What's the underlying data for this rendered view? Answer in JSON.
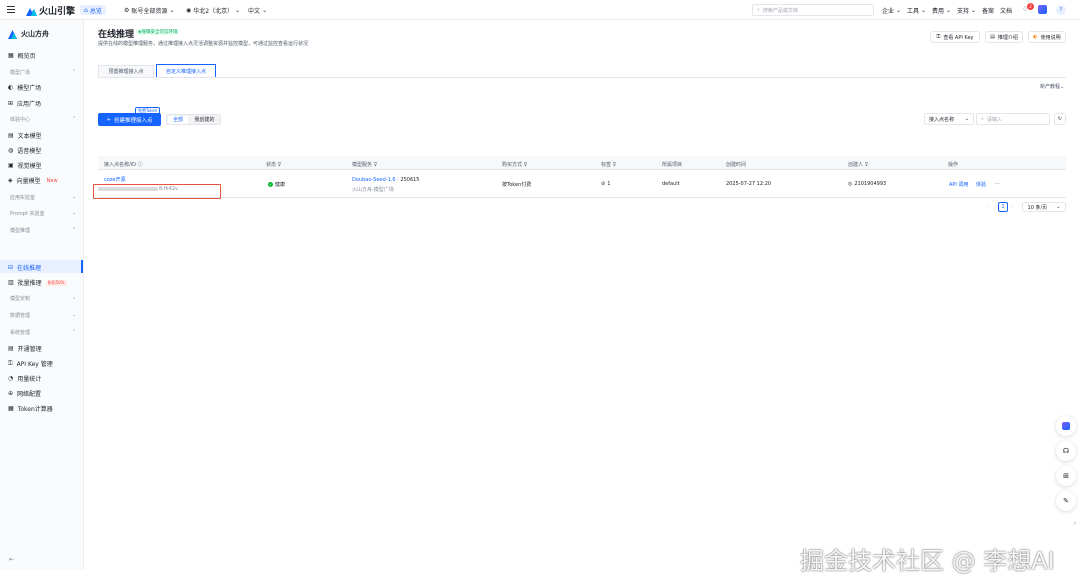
{
  "topbar": {
    "brand": "火山引擎",
    "home_tab": "总览",
    "resource_scope": "账号全部资源",
    "region": "华北2（北京）",
    "language": "中文",
    "search_placeholder": "搜索产品或文档",
    "menus": [
      "企业",
      "工具",
      "费用",
      "支持",
      "备案",
      "文档"
    ],
    "badge_count": "2"
  },
  "sidebar": {
    "product_name": "火山方舟",
    "overview": "概览页",
    "groups": {
      "explore": "模型广场",
      "experience": "体验中心",
      "app_lab": "应用实验室",
      "prompt": "Prompt 实验室",
      "model_inference": "模型推理",
      "model_custom": "模型定制",
      "data_mgmt": "数据管理",
      "system_mgmt": "系统管理"
    },
    "items": {
      "model_square": "模型广场",
      "app_square": "应用广场",
      "text_model": "文本模型",
      "voice_model": "语音模型",
      "vision_model": "视觉模型",
      "vector_model": "向量模型",
      "new_badge": "New",
      "online_infer": "在线推理",
      "batch_infer": "批量推理",
      "batch_badge": "折扣50%",
      "activation": "开通管理",
      "api_key": "API Key 管理",
      "usage_stats": "用量统计",
      "network": "网络配置",
      "token_calc": "Token计算器"
    }
  },
  "page": {
    "title": "在线推理",
    "safety_tag": "保障安全可信环境",
    "description": "提供在线的模型推理服务，通过推理接入点灵活调整资源并监控模型，可通过监控查看运行状况",
    "btn_view_api_key": "查看 API Key",
    "btn_infer_intro": "推理介绍",
    "btn_usage_guide": "使用说明",
    "tabs": [
      "预置推理接入点",
      "自定义推理接入点"
    ],
    "active_tab": 1,
    "new_feature": "新产教程",
    "create_btn": "创建推理接入点",
    "free_token_tag": "免费Token",
    "filter_all": "全部",
    "filter_mine": "我创建的",
    "search_field_select": "接入点名称",
    "search_placeholder": "请输入"
  },
  "table": {
    "headers": [
      "接入点名称/ID",
      "状态",
      "模型服务",
      "购买方式",
      "标签",
      "所属项目",
      "创建时间",
      "创建人",
      "操作"
    ],
    "rows": [
      {
        "name": "coze开源",
        "id_suffix": "8-fk42v",
        "status": "健康",
        "model": "Doubao-Seed-1.6",
        "model_version": "250615",
        "model_source": "火山方舟-模型广场",
        "purchase": "按Token付费",
        "tag_count": "1",
        "project": "default",
        "created": "2025-07-27 12:20",
        "creator": "2101904993",
        "action_api": "API 调用",
        "action_try": "体验",
        "action_more": "···"
      }
    ]
  },
  "pagination": {
    "current": "1",
    "page_size": "10 条/页"
  },
  "watermark": "掘金技术社区 @ 李想AI"
}
